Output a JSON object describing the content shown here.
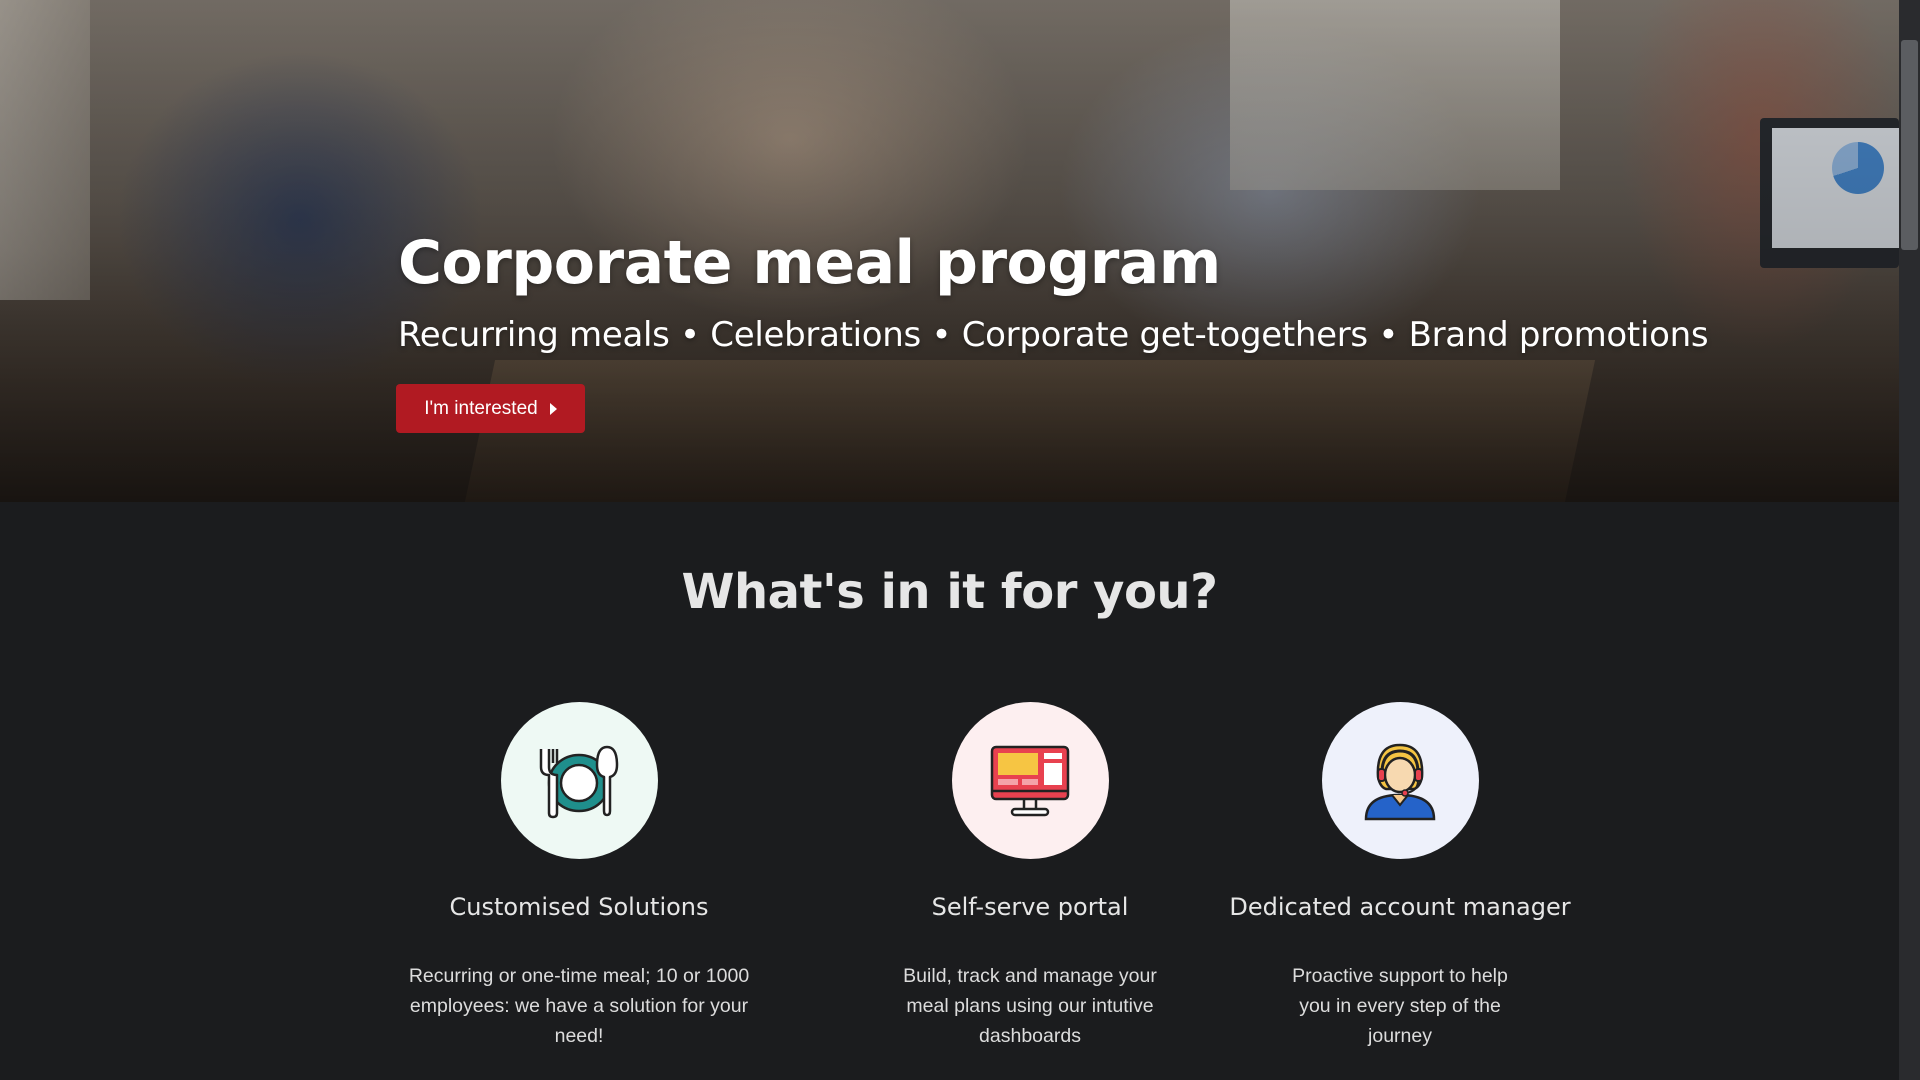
{
  "hero": {
    "title": "Corporate meal program",
    "subtitle": "Recurring meals • Celebrations • Corporate get-togethers • Brand promotions",
    "cta_label": "I'm interested",
    "cta_icon": "caret-right-icon",
    "cta_color": "#b11a22",
    "image_name": "office-team-lunch-photo"
  },
  "benefits": {
    "heading": "What's in it for you?",
    "items": [
      {
        "icon": "cutlery-plate-icon",
        "icon_bg": "#eef9f4",
        "title": "Customised Solutions",
        "description": "Recurring or one-time meal; 10 or 1000 employees: we have a solution for your need!"
      },
      {
        "icon": "monitor-dashboard-icon",
        "icon_bg": "#fdeff0",
        "title": "Self-serve portal",
        "description": "Build, track and manage your meal plans using our intutive dashboards"
      },
      {
        "icon": "headset-agent-icon",
        "icon_bg": "#eef1fb",
        "title": "Dedicated account manager",
        "description": "Proactive support to help you in every step of the journey"
      }
    ]
  },
  "theme": {
    "page_bg": "#1b1c1e",
    "text": "#e6e6e6"
  }
}
